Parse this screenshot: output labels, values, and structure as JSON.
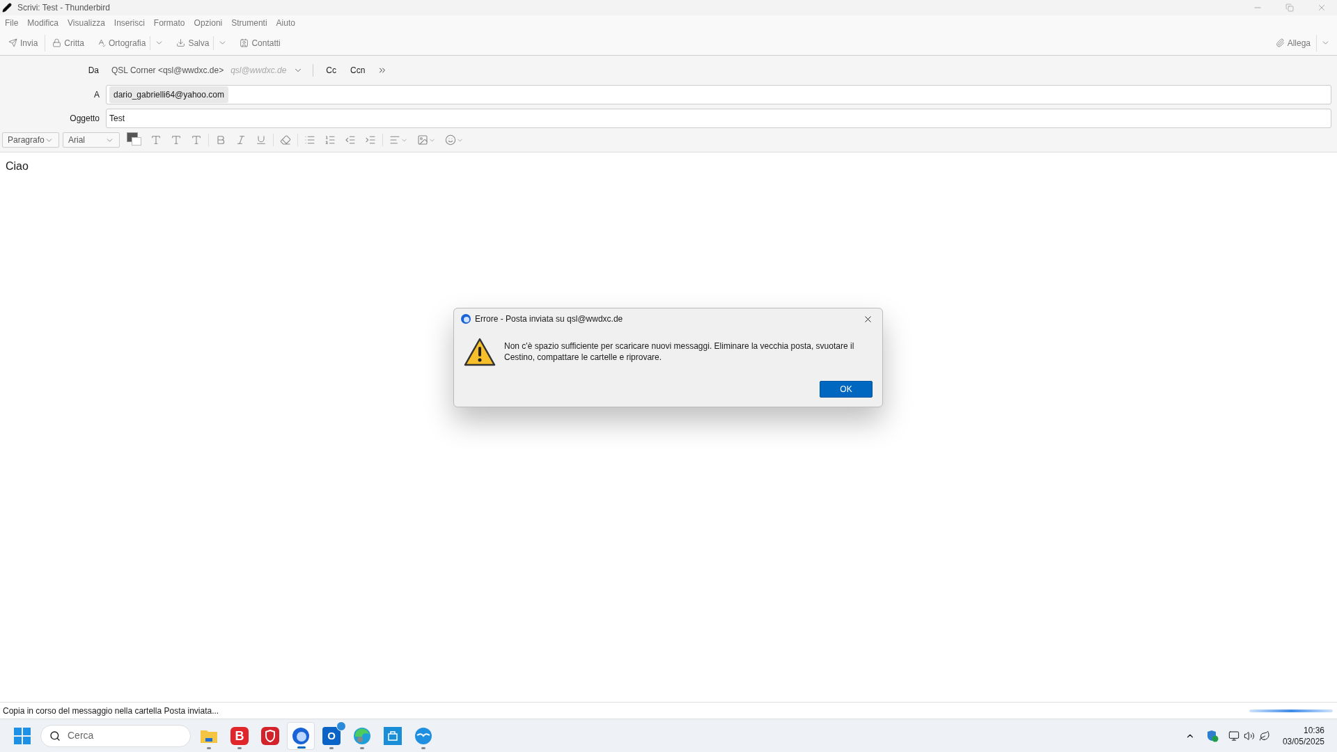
{
  "window": {
    "title": "Scrivi: Test - Thunderbird"
  },
  "menu": [
    "File",
    "Modifica",
    "Visualizza",
    "Inserisci",
    "Formato",
    "Opzioni",
    "Strumenti",
    "Aiuto"
  ],
  "toolbar": {
    "items": [
      {
        "kind": "send",
        "label": "Invia"
      },
      {
        "kind": "encrypt",
        "label": "Critta"
      },
      {
        "kind": "spelling",
        "label": "Ortografia"
      },
      {
        "kind": "menu"
      },
      {
        "kind": "save",
        "label": "Salva"
      },
      {
        "kind": "menu"
      },
      {
        "kind": "contacts",
        "label": "Contatti"
      }
    ],
    "attach": {
      "label": "Allega"
    }
  },
  "header": {
    "from": {
      "label": "Da",
      "identity": "QSL Corner <qsl@wwdxc.de>",
      "address": "qsl@wwdxc.de"
    },
    "cc": "Cc",
    "bcc": "Ccn",
    "to": {
      "label": "A",
      "recipients": [
        "dario_gabrielli64@yahoo.com"
      ]
    },
    "subject": {
      "label": "Oggetto",
      "value": "Test"
    }
  },
  "format_bar": {
    "paragraph": "Paragrafo",
    "font": "Arial",
    "color": "#555555"
  },
  "body": "Ciao",
  "dialog": {
    "title": "Errore - Posta inviata su qsl@wwdxc.de",
    "message": "Non c'è spazio sufficiente per scaricare nuovi messaggi. Eliminare la vecchia posta, svuotare il Cestino, compattare le cartelle e riprovare.",
    "button": "OK"
  },
  "status_bar": {
    "text": "Copia in corso del messaggio nella cartella Posta inviata...",
    "progress": {
      "level": 1
    }
  },
  "taskbar": {
    "search": {
      "placeholder": "Cerca"
    },
    "apps": [
      {
        "kind": "folder",
        "running": true,
        "selected": false
      },
      {
        "kind": "b",
        "glyph": "B",
        "running": true,
        "selected": false
      },
      {
        "kind": "shield",
        "running": false,
        "selected": false
      },
      {
        "kind": "bird",
        "running": true,
        "selected": true
      },
      {
        "kind": "outlook",
        "glyph": "O",
        "running": true,
        "selected": false
      },
      {
        "kind": "edge",
        "running": true,
        "selected": false
      },
      {
        "kind": "store",
        "running": false,
        "selected": false
      },
      {
        "kind": "gull",
        "running": true,
        "selected": false
      }
    ],
    "time": "10:36",
    "date": "03/05/2025"
  }
}
